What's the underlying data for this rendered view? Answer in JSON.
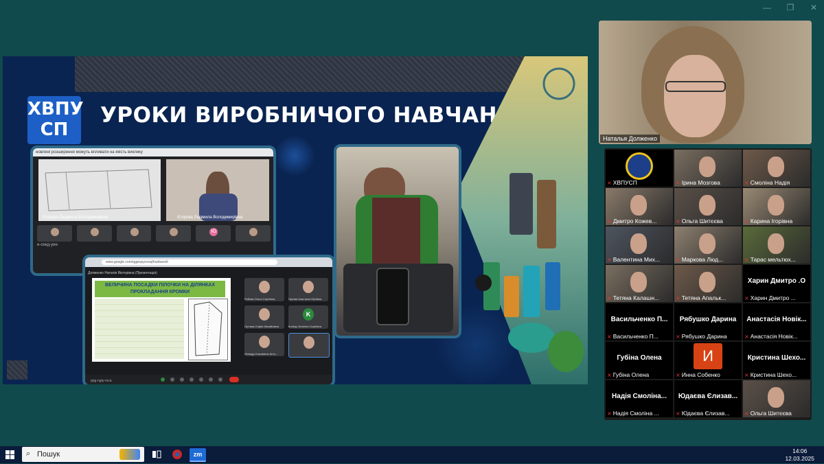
{
  "window_controls": [
    "—",
    "❐",
    "✕"
  ],
  "slide": {
    "logo_line1": "ХВПУ",
    "logo_line2": "СП",
    "title": "УРОКИ ВИРОБНИЧОГО НАВЧАННЯ:",
    "frame1": {
      "warning": "новлені розширення можуть впливати на якість виклику",
      "presenter_left": "Єгорова Людмила Володимирівна",
      "presenter_right": "Єгорова Людмила Володимирівна",
      "strip_label": "е-оокд-уин",
      "avatar_letter": "Ю"
    },
    "frame2": {
      "url": "www.google.com/qgprqsyvceq/hunbanvtl",
      "presenter": "Долженко Наталія Вікторівна (Презентація)",
      "doc_title": "ВЕЛИЧИНА ПОСАДКИ ПІЛОЧКИ НА ДІЛЯНКАХ ПРОКЛАДАННЯ КРОМКИ",
      "meeting_code": "ppg-ngty-mca",
      "participants": [
        {
          "name": "Рябова Ольга Сергіївна"
        },
        {
          "name": "Лукова Анастасія Юріївна"
        },
        {
          "name": "Лутчвак Софія Михайлівна"
        },
        {
          "name": "Колець Юлення Сергіївна",
          "letter": "K"
        },
        {
          "name": "Ліннадр Єлизавета Анто..."
        },
        {
          "name": ""
        }
      ]
    }
  },
  "speaker": {
    "name": "Наталья Долженко"
  },
  "gallery": [
    {
      "name": "ХВПУСП",
      "type": "logo"
    },
    {
      "name": "Ірина Мозгова",
      "type": "video"
    },
    {
      "name": "Смоліна Надія",
      "type": "video"
    },
    {
      "name": "Дмитро Кожев...",
      "type": "video"
    },
    {
      "name": "Ольга Шитєєва",
      "type": "video"
    },
    {
      "name": "Карина Ігорівна",
      "type": "video"
    },
    {
      "name": "Валентина Мих...",
      "type": "video"
    },
    {
      "name": "Маркова Люд...",
      "type": "video"
    },
    {
      "name": "Тарас мельтюх...",
      "type": "video"
    },
    {
      "name": "Тетяна Калашн...",
      "type": "video"
    },
    {
      "name": "Тетяна Апальк...",
      "type": "video"
    },
    {
      "name": "Харин Дмитро ...",
      "type": "text",
      "big": "Харин Дмитро .О"
    },
    {
      "name": "Васильченко П...",
      "type": "text",
      "big": "Васильченко П..."
    },
    {
      "name": "Рябушко Дарина",
      "type": "text",
      "big": "Рябушко Дарина"
    },
    {
      "name": "Анастасія Новік...",
      "type": "text",
      "big": "Анастасія Новік..."
    },
    {
      "name": "Губіна Олена",
      "type": "text",
      "big": "Губіна Олена"
    },
    {
      "name": "Инна Собенко",
      "type": "initial",
      "big": "И"
    },
    {
      "name": "Кристина Шехо...",
      "type": "text",
      "big": "Кристина Шехо..."
    },
    {
      "name": "Надія Смоліна ...",
      "type": "text",
      "big": "Надія Смоліна..."
    },
    {
      "name": "Юдаєва Єлизав...",
      "type": "text",
      "big": "Юдаєва Єлизав..."
    },
    {
      "name": "Ольга Шитєєва",
      "type": "video"
    }
  ],
  "taskbar": {
    "search_placeholder": "Пошук",
    "time": "14:06",
    "date": "12.03.2025"
  },
  "colors": {
    "background": "#114a4c",
    "slide": "#0a2451",
    "muted_mic": "#e53935",
    "initial_avatar": "#d84315",
    "taskbar": "#0b1b3a"
  }
}
